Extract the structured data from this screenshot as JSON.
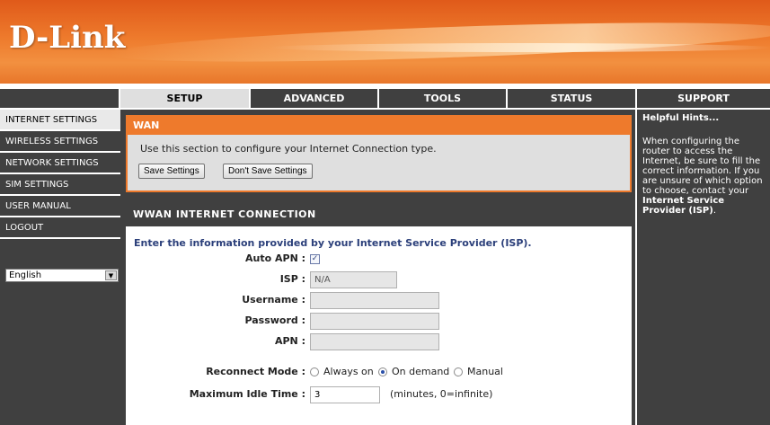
{
  "header": {
    "logo_text": "D-Link"
  },
  "nav": {
    "tabs": [
      {
        "label": "SETUP"
      },
      {
        "label": "ADVANCED"
      },
      {
        "label": "TOOLS"
      },
      {
        "label": "STATUS"
      },
      {
        "label": "SUPPORT"
      }
    ],
    "active": "SETUP"
  },
  "sidebar": {
    "items": [
      {
        "label": "INTERNET SETTINGS"
      },
      {
        "label": "WIRELESS SETTINGS"
      },
      {
        "label": "NETWORK SETTINGS"
      },
      {
        "label": "SIM SETTINGS"
      },
      {
        "label": "USER MANUAL"
      },
      {
        "label": "LOGOUT"
      }
    ],
    "language": "English"
  },
  "wan": {
    "title": "WAN",
    "description": "Use this section to configure your Internet Connection type.",
    "save_label": "Save Settings",
    "dont_save_label": "Don't Save Settings"
  },
  "wwan": {
    "title": "WWAN INTERNET CONNECTION",
    "isp_note": "Enter the information provided by your Internet Service Provider (ISP).",
    "auto_apn_label": "Auto APN :",
    "auto_apn_checked": true,
    "isp_label": "ISP :",
    "isp_value": "N/A",
    "username_label": "Username :",
    "username_value": "",
    "password_label": "Password :",
    "password_value": "",
    "apn_label": "APN :",
    "apn_value": "",
    "reconnect_label": "Reconnect Mode :",
    "reconnect_options": [
      "Always on",
      "On demand",
      "Manual"
    ],
    "reconnect_selected": "On demand",
    "idle_label": "Maximum Idle Time :",
    "idle_value": "3",
    "idle_hint": "(minutes, 0=infinite)"
  },
  "support": {
    "title": "Helpful Hints...",
    "hint_text_1": "When configuring the router to access the Internet, be sure to fill the correct information. If you are unsure of which option to choose, contact your",
    "hint_bold": "Internet Service Provider (ISP)",
    "hint_end": "."
  },
  "colors": {
    "accent": "#ee7a2c",
    "dark": "#404040",
    "panel": "#dfdfdf"
  }
}
